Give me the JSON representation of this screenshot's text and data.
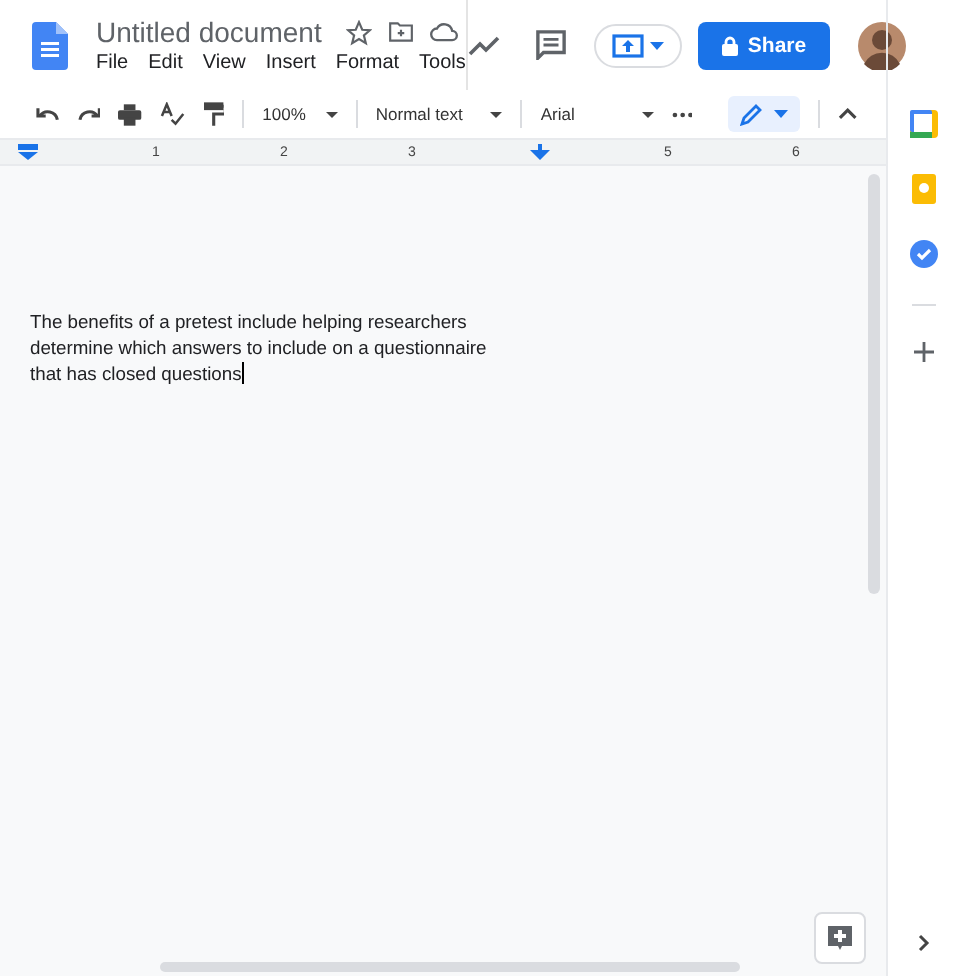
{
  "header": {
    "title": "Untitled document",
    "menu": [
      {
        "label": "File"
      },
      {
        "label": "Edit"
      },
      {
        "label": "View"
      },
      {
        "label": "Insert"
      },
      {
        "label": "Format"
      },
      {
        "label": "Tools"
      }
    ],
    "share_button": "Share"
  },
  "toolbar": {
    "zoom": "100%",
    "style": "Normal text",
    "font": "Arial"
  },
  "ruler": [
    {
      "kind": "label",
      "text": "1"
    },
    {
      "kind": "label",
      "text": "2"
    },
    {
      "kind": "label",
      "text": "3"
    },
    {
      "kind": "tab-stop"
    },
    {
      "kind": "label",
      "text": "5"
    },
    {
      "kind": "label",
      "text": "6"
    }
  ],
  "document": {
    "text": "The benefits of a pretest include helping researchers determine which answers to include on a questionnaire that has closed questions"
  }
}
